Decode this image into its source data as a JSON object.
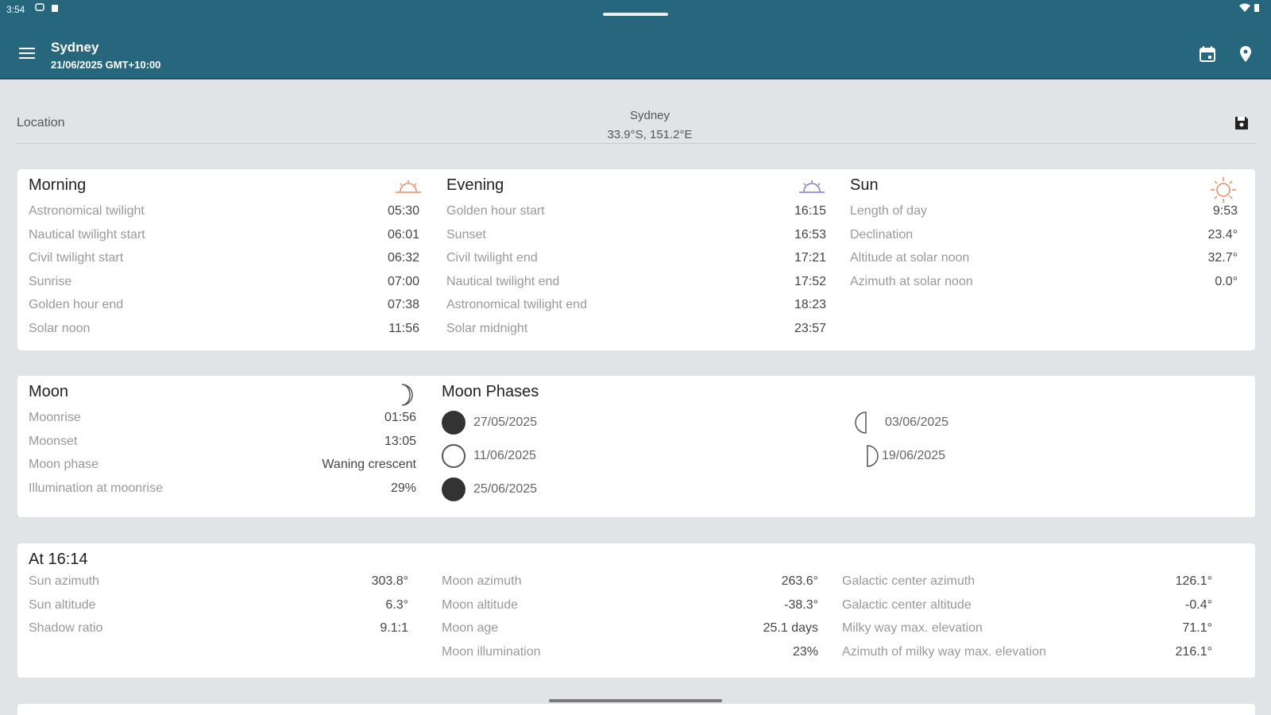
{
  "status": {
    "time": "3:54"
  },
  "app": {
    "title": "Sydney",
    "subtitle": "21/06/2025 GMT+10:00"
  },
  "location": {
    "label": "Location",
    "name": "Sydney",
    "coords": "33.9°S, 151.2°E"
  },
  "morning": {
    "title": "Morning",
    "rows": [
      {
        "k": "Astronomical twilight",
        "v": "05:30"
      },
      {
        "k": "Nautical twilight start",
        "v": "06:01"
      },
      {
        "k": "Civil twilight start",
        "v": "06:32"
      },
      {
        "k": "Sunrise",
        "v": "07:00"
      },
      {
        "k": "Golden hour end",
        "v": "07:38"
      },
      {
        "k": "Solar noon",
        "v": "11:56"
      }
    ]
  },
  "evening": {
    "title": "Evening",
    "rows": [
      {
        "k": "Golden hour start",
        "v": "16:15"
      },
      {
        "k": "Sunset",
        "v": "16:53"
      },
      {
        "k": "Civil twilight end",
        "v": "17:21"
      },
      {
        "k": "Nautical twilight end",
        "v": "17:52"
      },
      {
        "k": "Astronomical twilight end",
        "v": "18:23"
      },
      {
        "k": "Solar midnight",
        "v": "23:57"
      }
    ]
  },
  "sun": {
    "title": "Sun",
    "rows": [
      {
        "k": "Length of day",
        "v": "9:53"
      },
      {
        "k": "Declination",
        "v": "23.4°"
      },
      {
        "k": "Altitude at solar noon",
        "v": "32.7°"
      },
      {
        "k": "Azimuth at solar noon",
        "v": "0.0°"
      }
    ]
  },
  "moon": {
    "title": "Moon",
    "rows": [
      {
        "k": "Moonrise",
        "v": "01:56"
      },
      {
        "k": "Moonset",
        "v": "13:05"
      },
      {
        "k": "Moon phase",
        "v": "Waning crescent"
      },
      {
        "k": "Illumination at moonrise",
        "v": "29%"
      }
    ]
  },
  "phases": {
    "title": "Moon Phases",
    "items": [
      {
        "type": "new-moon",
        "date": "27/05/2025"
      },
      {
        "type": "full-moon",
        "date": "11/06/2025"
      },
      {
        "type": "new-moon",
        "date": "25/06/2025"
      },
      {
        "type": "first-quarter",
        "date": "03/06/2025"
      },
      {
        "type": "last-quarter",
        "date": "19/06/2025"
      }
    ]
  },
  "at": {
    "title": "At 16:14",
    "col1": [
      {
        "k": "Sun azimuth",
        "v": "303.8°"
      },
      {
        "k": "Sun altitude",
        "v": "6.3°"
      },
      {
        "k": "Shadow ratio",
        "v": "9.1:1"
      }
    ],
    "col2": [
      {
        "k": "Moon azimuth",
        "v": "263.6°"
      },
      {
        "k": "Moon altitude",
        "v": "-38.3°"
      },
      {
        "k": "Moon age",
        "v": "25.1 days"
      },
      {
        "k": "Moon illumination",
        "v": "23%"
      }
    ],
    "col3": [
      {
        "k": "Galactic center azimuth",
        "v": "126.1°"
      },
      {
        "k": "Galactic center altitude",
        "v": "-0.4°"
      },
      {
        "k": "Milky way max. elevation",
        "v": "71.1°"
      },
      {
        "k": "Azimuth of milky way max. elevation",
        "v": "216.1°"
      }
    ]
  },
  "colors": {
    "appbar": "#27677e",
    "background": "#e1e4e6",
    "sunrise": "#f08a5d",
    "sunset": "#7a7ad8"
  }
}
